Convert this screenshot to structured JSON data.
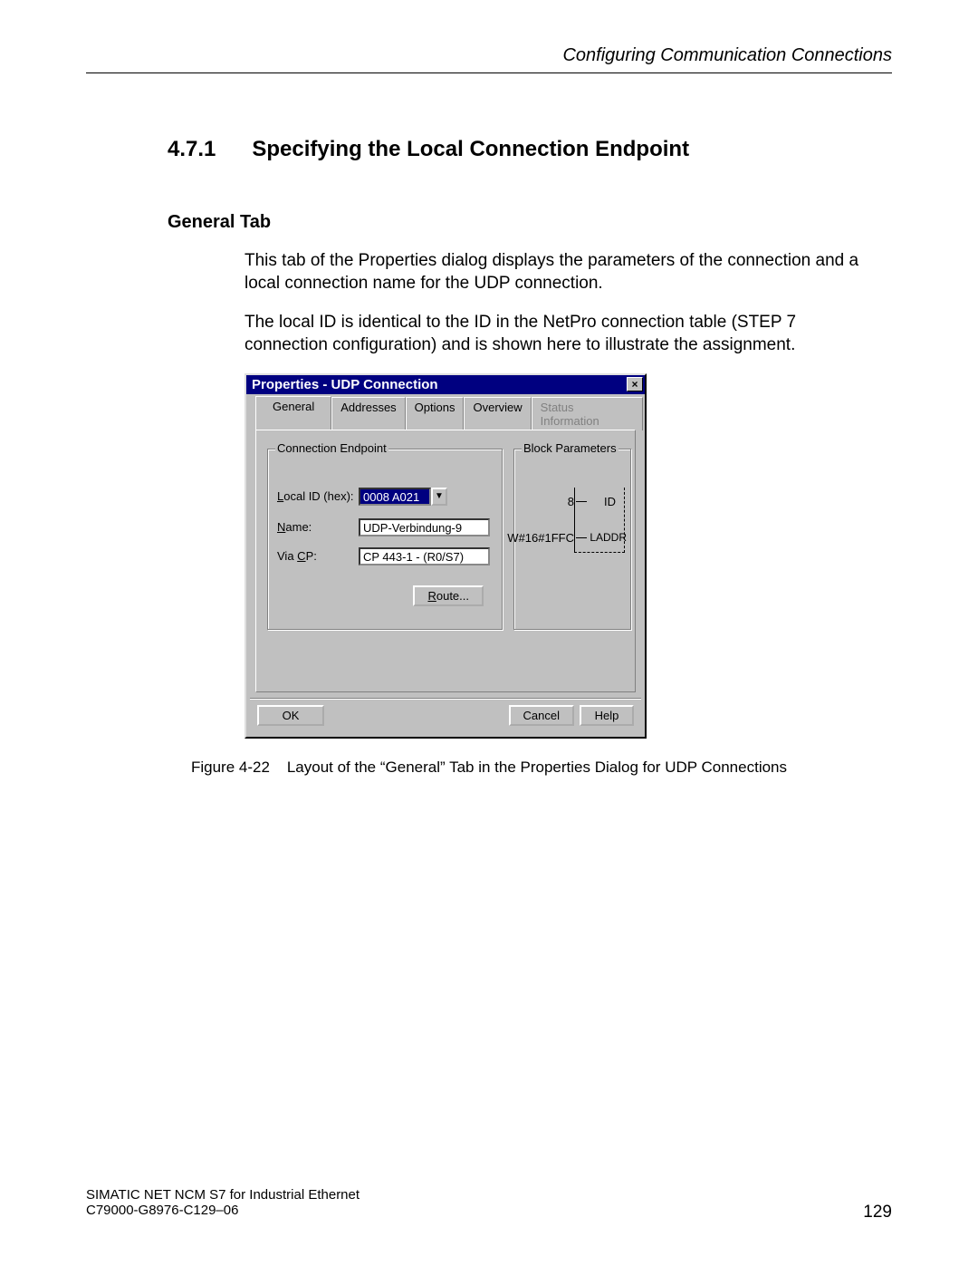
{
  "header": {
    "running_title": "Configuring Communication Connections"
  },
  "section": {
    "number": "4.7.1",
    "title": "Specifying the Local Connection Endpoint"
  },
  "subsection": {
    "title": "General Tab"
  },
  "paragraphs": {
    "p1": "This tab of the Properties dialog displays the parameters of the connection and a local connection name for the UDP connection.",
    "p2": "The local ID is identical to the ID in the NetPro connection table (STEP 7 connection configuration) and is shown here to illustrate the assignment."
  },
  "figure": {
    "caption_prefix": "Figure 4-22",
    "caption_text": "Layout of the “General” Tab in the Properties Dialog for UDP Connections"
  },
  "dialog": {
    "title": "Properties - UDP Connection",
    "close_icon": "×",
    "tabs": {
      "general": "General",
      "addresses": "Addresses",
      "options": "Options",
      "overview": "Overview",
      "status": "Status Information"
    },
    "group_connection": {
      "legend": "Connection Endpoint",
      "local_id_label_pre": "L",
      "local_id_label_post": "ocal ID (hex):",
      "local_id_value": "0008 A021",
      "name_label_pre": "N",
      "name_label_post": "ame:",
      "name_value": "UDP-Verbindung-9",
      "via_cp_label_pre": "Via ",
      "via_cp_label_ul": "C",
      "via_cp_label_post": "P:",
      "via_cp_value": "CP 443-1 - (R0/S7)",
      "route_btn_pre": "R",
      "route_btn_post": "oute..."
    },
    "group_block": {
      "legend": "Block Parameters",
      "id_value": "8",
      "id_label": "ID",
      "laddr_value": "W#16#1FFC",
      "laddr_label": "LADDR"
    },
    "buttons": {
      "ok": "OK",
      "cancel": "Cancel",
      "help": "Help"
    }
  },
  "footer": {
    "line1": "SIMATIC NET NCM S7 for Industrial Ethernet",
    "line2": "C79000-G8976-C129–06",
    "page": "129"
  }
}
